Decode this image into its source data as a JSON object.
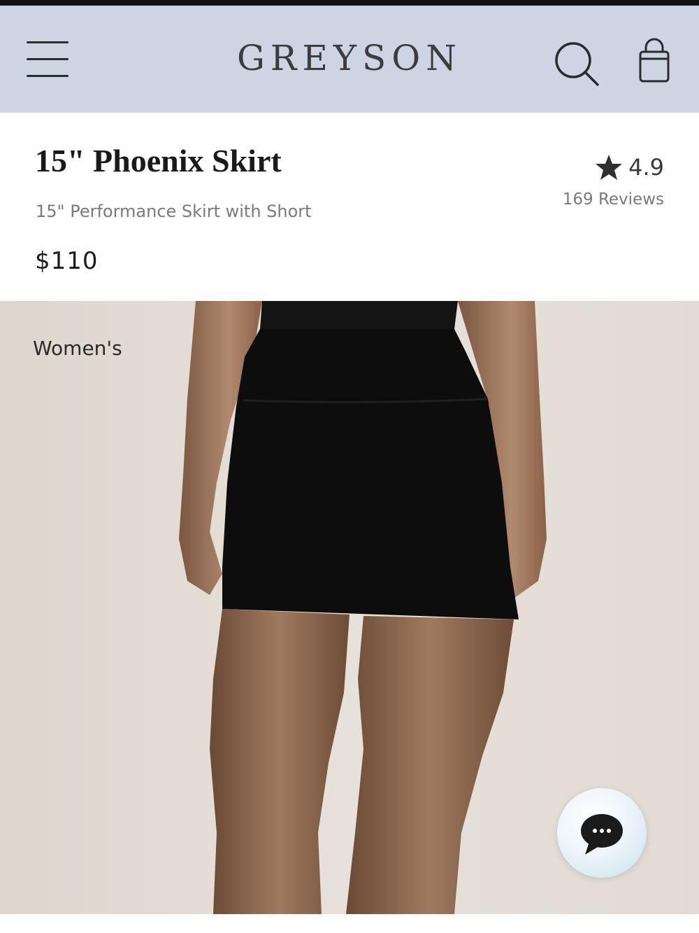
{
  "header": {
    "brand": "GREYSON",
    "menu_icon": "hamburger-menu-icon",
    "search_icon": "search-icon",
    "bag_icon": "shopping-bag-icon",
    "background_color": "#cdd5e3"
  },
  "product": {
    "title": "15\" Phoenix Skirt",
    "subtitle": "15\" Performance Skirt with Short",
    "price": "$110",
    "rating": "4.9",
    "reviews": "169 Reviews",
    "rating_icon": "star-icon"
  },
  "hero": {
    "category": "Women's",
    "image_subject": "model wearing black skirt"
  },
  "chat": {
    "icon": "chat-bubble-icon"
  }
}
